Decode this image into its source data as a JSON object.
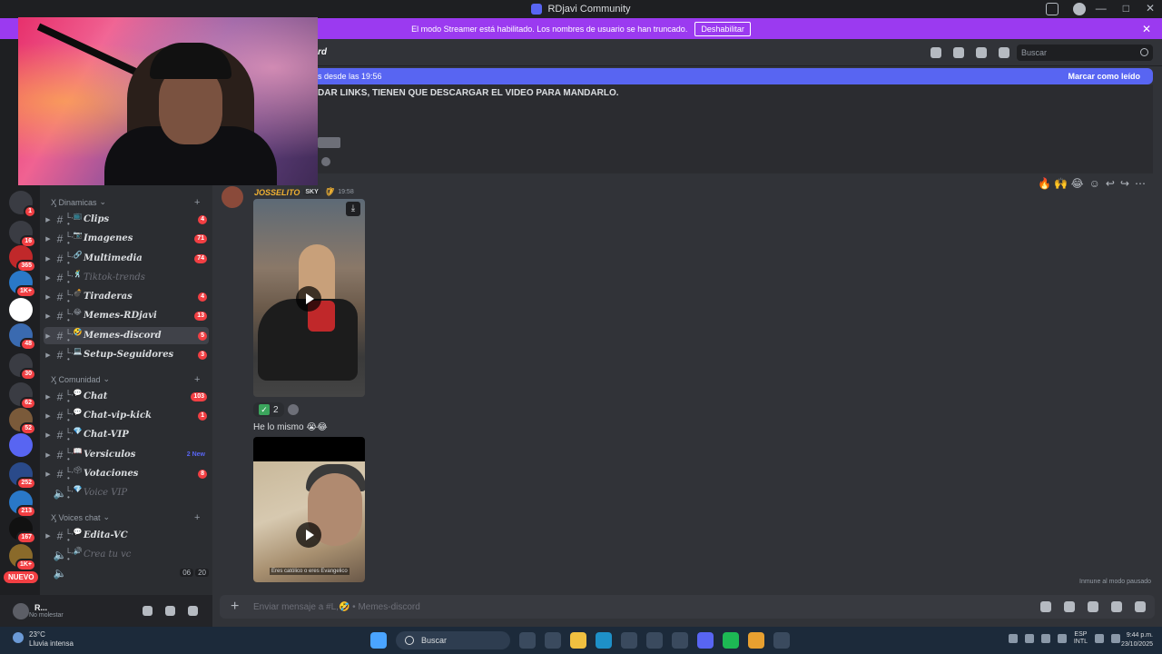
{
  "window": {
    "title": "RDjavi Community",
    "controls": [
      "—",
      "□",
      "✕"
    ]
  },
  "banner": {
    "text": "El modo Streamer está habilitado. Los nombres de usuario se han truncado.",
    "button": "Deshabilitar",
    "close": "✕"
  },
  "guilds": {
    "badges": [
      "1",
      "16",
      "365",
      "1K+",
      "48",
      "30",
      "62",
      "52",
      "252",
      "213",
      "167",
      "1K+"
    ],
    "new_label": "NUEVO"
  },
  "categories": {
    "dinamicas": "Ӽ Dinamicas",
    "comunidad": "Ӽ Comunidad",
    "voices": "Ӽ Voices chat"
  },
  "channels": [
    {
      "name": "Clips",
      "prefix": "L,📺 •",
      "count": "4"
    },
    {
      "name": "Imagenes",
      "prefix": "L,📷 •",
      "count": "71"
    },
    {
      "name": "Multimedia",
      "prefix": "L,🔗 •",
      "count": "74"
    },
    {
      "name": "Tiktok-trends",
      "prefix": "L,🕺 •",
      "count": ""
    },
    {
      "name": "Tiraderas",
      "prefix": "L,💣 •",
      "count": "4"
    },
    {
      "name": "Memes-RDjavi",
      "prefix": "L,😂 •",
      "count": "13"
    },
    {
      "name": "Memes-discord",
      "prefix": "L,🤣 •",
      "count": "5"
    },
    {
      "name": "Setup-Seguidores",
      "prefix": "L,💻 •",
      "count": "3"
    },
    {
      "name": "Chat",
      "prefix": "L,💬 •",
      "count": "103"
    },
    {
      "name": "Chat-vip-kick",
      "prefix": "L,💬 •",
      "count": "1"
    },
    {
      "name": "Chat-VIP",
      "prefix": "L,💎 •",
      "count": ""
    },
    {
      "name": "Versiculos",
      "prefix": "L,📖 •",
      "new": "2 New"
    },
    {
      "name": "Votaciones",
      "prefix": "L,🗳 •",
      "count": "8"
    },
    {
      "name": "Voice VIP",
      "prefix": "L,💎 •",
      "count": ""
    },
    {
      "name": "Edita-VC",
      "prefix": "L,💬 •",
      "count": ""
    },
    {
      "name": "Crea tu vc",
      "prefix": "L,🔊 •",
      "count": ""
    }
  ],
  "voice_row": {
    "a": "06",
    "b": "20"
  },
  "user": {
    "name": "R...",
    "status": "No molestar"
  },
  "header": {
    "channel": "rd",
    "search_placeholder": "Buscar"
  },
  "chat": {
    "new_messages": "s desde las 19:56",
    "mark_read": "Marcar como leído",
    "notice": "DAR LINKS, TIENEN QUE DESCARGAR EL VIDEO PARA MANDARLO.",
    "author": "JOSSELITO",
    "author_tag": "SKY",
    "time": "19:58",
    "reaction_count": "2",
    "message_text": "He lo mismo 😭😂",
    "video_caption": "Eres católico o eres Evangelico",
    "immune": "Inmune al modo pausado",
    "actions": "🔥 🙌 😂"
  },
  "composer": {
    "placeholder": "Enviar mensaje a #L,🤣 • Memes-discord"
  },
  "taskbar": {
    "temp": "23°C",
    "weather": "Lluvia intensa",
    "search": "Buscar",
    "lang1": "ESP",
    "lang2": "INTL",
    "time": "9:44 p.m.",
    "date": "23/10/2025"
  }
}
